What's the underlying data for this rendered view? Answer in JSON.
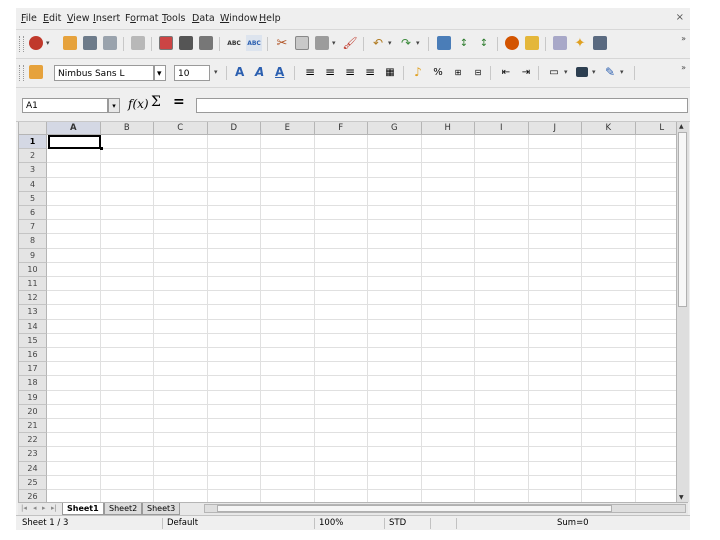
{
  "menu": {
    "items": [
      {
        "pre": "",
        "u": "F",
        "post": "ile"
      },
      {
        "pre": "",
        "u": "E",
        "post": "dit"
      },
      {
        "pre": "",
        "u": "V",
        "post": "iew"
      },
      {
        "pre": "",
        "u": "I",
        "post": "nsert"
      },
      {
        "pre": "F",
        "u": "o",
        "post": "rmat"
      },
      {
        "pre": "",
        "u": "T",
        "post": "ools"
      },
      {
        "pre": "",
        "u": "D",
        "post": "ata"
      },
      {
        "pre": "",
        "u": "W",
        "post": "indow"
      },
      {
        "pre": "",
        "u": "H",
        "post": "elp"
      }
    ],
    "close_symbol": "×"
  },
  "toolbar": {
    "spell_label": "ABC",
    "autospell_label": "ABC",
    "overflow": "»",
    "dropdown": "▾"
  },
  "formatting": {
    "font_name": "Nimbus Sans L",
    "font_size": "10",
    "bold": "A",
    "italic": "A",
    "underline": "A",
    "percent": "%",
    "overflow": "»"
  },
  "formula_bar": {
    "name_box": "A1",
    "function_wizard": "f(x)",
    "sum": "Σ",
    "equals": "=",
    "content": ""
  },
  "sheet": {
    "columns": [
      "A",
      "B",
      "C",
      "D",
      "E",
      "F",
      "G",
      "H",
      "I",
      "J",
      "K",
      "L"
    ],
    "rows": [
      "1",
      "2",
      "3",
      "4",
      "5",
      "6",
      "7",
      "8",
      "9",
      "10",
      "11",
      "12",
      "13",
      "14",
      "15",
      "16",
      "17",
      "18",
      "19",
      "20",
      "21",
      "22",
      "23",
      "24",
      "25",
      "26"
    ],
    "selected_cell": "A1"
  },
  "tabs": {
    "sheets": [
      "Sheet1",
      "Sheet2",
      "Sheet3"
    ],
    "active": "Sheet1"
  },
  "status": {
    "sheet_pos": "Sheet 1 / 3",
    "page_style": "Default",
    "zoom": "100%",
    "mode": "STD",
    "sum": "Sum=0"
  },
  "icons": [
    "new-document-icon",
    "open-folder-icon",
    "save-icon",
    "email-icon",
    "edit-file-icon",
    "export-pdf-icon",
    "print-icon",
    "print-preview-icon",
    "spellcheck-icon",
    "autospellcheck-icon",
    "cut-icon",
    "copy-icon",
    "paste-icon",
    "format-paintbrush-icon",
    "undo-icon",
    "redo-icon",
    "hyperlink-icon",
    "sort-ascending-icon",
    "sort-descending-icon",
    "chart-icon",
    "draw-functions-icon",
    "navigator-icon",
    "gallery-icon"
  ],
  "colors": {
    "ui_bg": "#efefef",
    "header_bg": "#e4e4e4",
    "grid_line": "#e0e0e0",
    "accent_blue": "#2b5fb0"
  }
}
